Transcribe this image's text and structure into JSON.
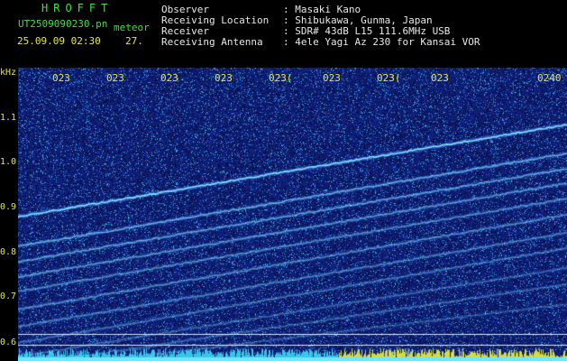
{
  "header": {
    "brand": "HROFFT",
    "file_name": "UT2509090230.pn",
    "file_tag": "meteor",
    "datetime": "25.09.09 02:30",
    "value": "27.",
    "fields": [
      {
        "label": "Observer",
        "value": ": Masaki Kano"
      },
      {
        "label": "Receiving Location",
        "value": ": Shibukawa, Gunma, Japan"
      },
      {
        "label": "Receiver",
        "value": ": SDR# 43dB L15 111.6MHz USB"
      },
      {
        "label": "Receiving Antenna",
        "value": ": 4ele Yagi Az 230 for Kansai VOR"
      }
    ]
  },
  "axis": {
    "y_unit": "kHz",
    "y_ticks": [
      "1.1",
      "1.0",
      "0.9",
      "0.8",
      "0.7",
      "0.6"
    ],
    "x_ticks": [
      "023",
      "023",
      "023",
      "023",
      "023(",
      "023",
      "023(",
      "023",
      "0240"
    ]
  },
  "colors": {
    "label_yellow": "#e6e63c",
    "brand_green": "#3ee13e",
    "background_blue": "#0a1478",
    "trace_cyan": "#8cf0ff"
  }
}
